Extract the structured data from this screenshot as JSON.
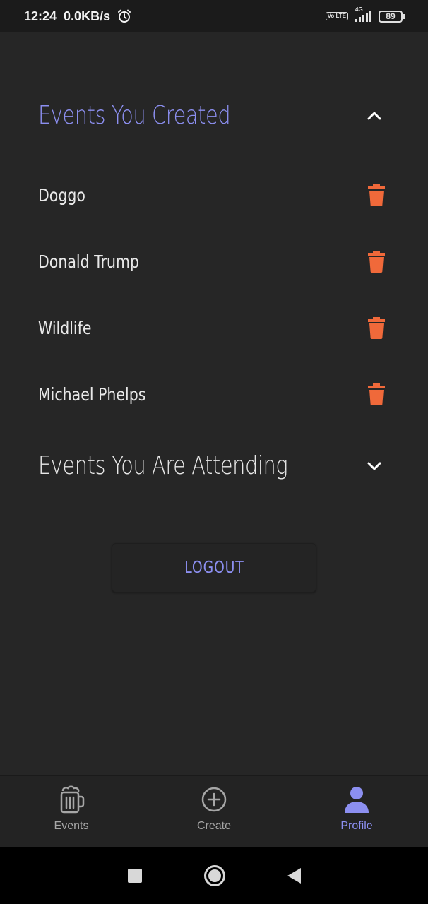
{
  "status_bar": {
    "time": "12:24",
    "speed": "0.0KB/s",
    "volte": "Vo LTE",
    "network": "4G",
    "battery": "89"
  },
  "created_section": {
    "title": "Events You Created",
    "expanded": true,
    "events": [
      {
        "name": "Doggo"
      },
      {
        "name": "Donald Trump"
      },
      {
        "name": "Wildlife"
      },
      {
        "name": "Michael Phelps"
      }
    ]
  },
  "attending_section": {
    "title": "Events You Are Attending",
    "expanded": false
  },
  "logout_label": "LOGOUT",
  "bottom_nav": [
    {
      "label": "Events",
      "icon": "beer-mug-icon",
      "active": false
    },
    {
      "label": "Create",
      "icon": "add-circle-icon",
      "active": false
    },
    {
      "label": "Profile",
      "icon": "person-icon",
      "active": true
    }
  ],
  "colors": {
    "accent": "#8c8ff0",
    "delete": "#f0693a",
    "background": "#262626"
  }
}
